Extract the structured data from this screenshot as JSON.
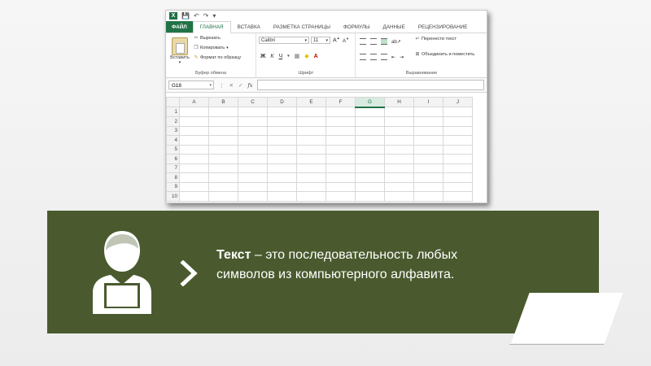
{
  "excel": {
    "tabs": [
      "ФАЙЛ",
      "ГЛАВНАЯ",
      "ВСТАВКА",
      "РАЗМЕТКА СТРАНИЦЫ",
      "ФОРМУЛЫ",
      "ДАННЫЕ",
      "РЕЦЕНЗИРОВАНИЕ"
    ],
    "clipboard": {
      "paste": "Вставить",
      "cut": "Вырезать",
      "copy": "Копировать",
      "format_painter": "Формат по образцу",
      "group_label": "Буфер обмена"
    },
    "font": {
      "name": "Calibri",
      "size": "11",
      "bold": "Ж",
      "italic": "К",
      "underline": "Ч",
      "group_label": "Шрифт"
    },
    "alignment": {
      "wrap_text": "Перенести текст",
      "merge_center": "Объединить и поместить",
      "group_label": "Выравнивание"
    },
    "formula_bar": {
      "name_box": "G18",
      "fx": "fx",
      "value": ""
    },
    "columns": [
      "A",
      "B",
      "C",
      "D",
      "E",
      "F",
      "G",
      "H",
      "I",
      "J"
    ],
    "selected_column": "G",
    "rows": [
      "1",
      "2",
      "3",
      "4",
      "5",
      "6",
      "7",
      "8",
      "9",
      "10"
    ]
  },
  "banner": {
    "term": "Текст",
    "definition": " – это последовательность любых символов из компьютерного алфавита.",
    "bg_color": "#4a5a2e"
  },
  "icons": {
    "person": "person-at-laptop-icon",
    "chevron": "chevron-right-icon"
  }
}
